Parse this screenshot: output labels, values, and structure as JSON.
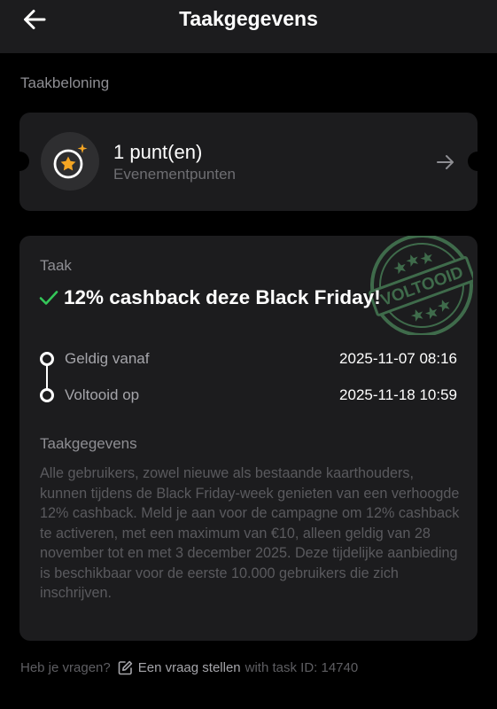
{
  "header": {
    "title": "Taakgegevens"
  },
  "reward": {
    "section_label": "Taakbeloning",
    "amount": "1 punt(en)",
    "type": "Evenementpunten"
  },
  "task": {
    "label": "Taak",
    "title": "12% cashback deze Black Friday!",
    "stamp_text": "VOLTOOID",
    "timeline": [
      {
        "label": "Geldig vanaf",
        "value": "2025-11-07 08:16"
      },
      {
        "label": "Voltooid op",
        "value": "2025-11-18 10:59"
      }
    ],
    "details_label": "Taakgegevens",
    "details_text": "Alle gebruikers, zowel nieuwe als bestaande kaarthouders, kunnen tijdens de Black Friday-week genieten van een verhoogde 12% cashback. Meld je aan voor de campagne om 12% cashback te activeren, met een maximum van €10, alleen geldig van 28 november tot en met 3 december 2025. Deze tijdelijke aanbieding is beschikbaar voor de eerste 10.000 gebruikers die zich inschrijven."
  },
  "footer": {
    "question": "Heb je vragen?",
    "ask_link": "Een vraag stellen",
    "task_id": "with task ID: 14740"
  },
  "colors": {
    "background": "#000000",
    "card": "#1c1c1e",
    "check": "#34c759",
    "star": "#f5a623",
    "stamp": "#3f6b4b"
  },
  "icons": {
    "back": "arrow-left-icon",
    "reward": "star-coin-icon",
    "reward_arrow": "arrow-right-icon",
    "check": "check-icon",
    "ask": "edit-icon"
  }
}
